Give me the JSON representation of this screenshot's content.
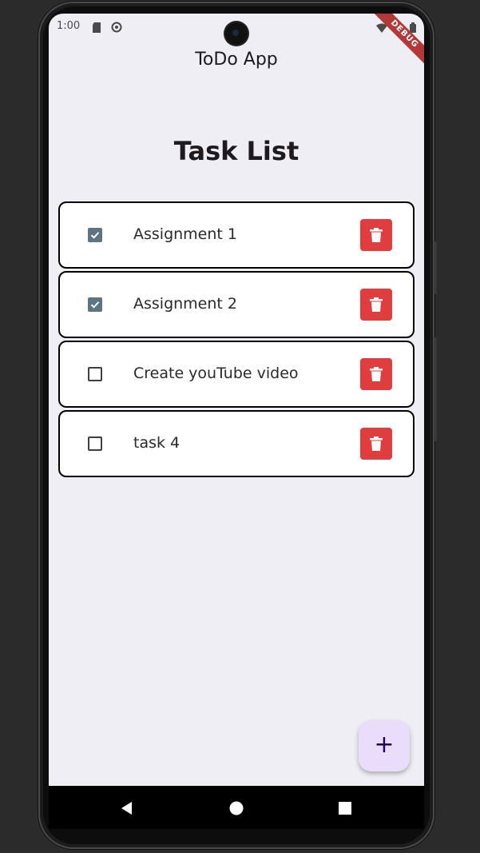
{
  "status_bar": {
    "time": "1:00",
    "icons": [
      "sd-card-icon",
      "at-sign-icon",
      "wifi-icon",
      "battery-icon"
    ]
  },
  "debug_banner": "DEBUG",
  "app_bar": {
    "title": "ToDo App"
  },
  "page": {
    "title": "Task List"
  },
  "tasks": [
    {
      "label": "Assignment 1",
      "checked": true
    },
    {
      "label": "Assignment 2",
      "checked": true
    },
    {
      "label": "Create youTube video",
      "checked": false
    },
    {
      "label": "task 4",
      "checked": false
    }
  ],
  "fab": {
    "label": "+"
  },
  "nav": {
    "icons": [
      "back-triangle-icon",
      "home-circle-icon",
      "recents-square-icon"
    ]
  },
  "colors": {
    "screen_background": "#eeeef4",
    "checkbox_checked": "#5d7482",
    "delete_button": "#e03e3e",
    "fab_background": "#eadcfb",
    "fab_icon": "#21005d",
    "debug_ribbon": "#b33939"
  }
}
